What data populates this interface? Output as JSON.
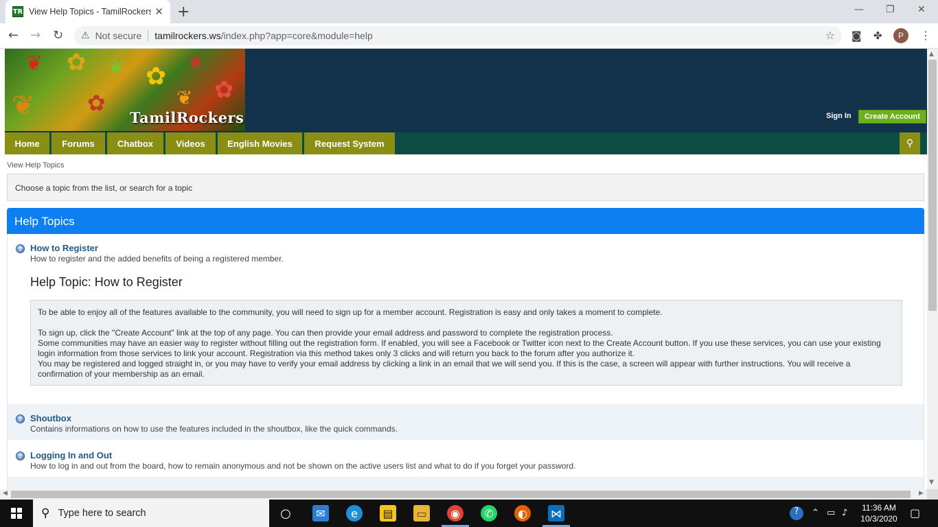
{
  "browser": {
    "tab_title": "View Help Topics - TamilRockers.ws",
    "favicon_text": "TR",
    "not_secure": "Not secure",
    "url_host": "tamilrockers.ws",
    "url_path": "/index.php?app=core&module=help",
    "profile_initial": "P"
  },
  "header": {
    "logo_text": "TamilRockers.com",
    "sign_in": "Sign In",
    "create_account": "Create Account"
  },
  "nav": {
    "items": [
      "Home",
      "Forums",
      "Chatbox",
      "Videos",
      "English Movies",
      "Request System"
    ]
  },
  "page": {
    "breadcrumb": "View Help Topics",
    "info": "Choose a topic from the list, or search for a topic",
    "panel_title": "Help Topics"
  },
  "topics": [
    {
      "title": "How to Register",
      "desc": "How to register and the added benefits of being a registered member."
    },
    {
      "title": "Shoutbox",
      "desc": "Contains informations on how to use the features included in the shoutbox, like the quick commands."
    },
    {
      "title": "Logging In and Out",
      "desc": "How to log in and out from the board, how to remain anonymous and not be shown on the active users list and what to do if you forget your password."
    }
  ],
  "help_topic": {
    "heading": "Help Topic: How to Register",
    "p1": "To be able to enjoy all of the features available to the community, you will need to sign up for a member account. Registration is easy and only takes a moment to complete.",
    "p2": "To sign up, click the \"Create Account\" link at the top of any page. You can then provide your email address and password to complete the registration process.",
    "p3": "Some communities may have an easier way to register without filling out the registration form. If enabled, you will see a Facebook or Twitter icon next to the Create Account button. If you use these services, you can use your existing login information from those services to link your account. Registration via this method takes only 3 clicks and will return you back to the forum after you authorize it.",
    "p4": "You may be registered and logged straight in, or you may have to verify your email address by clicking a link in an email that we will send you. If this is the case, a screen will appear with further instructions. You will receive a confirmation of your membership as an email."
  },
  "taskbar": {
    "search_placeholder": "Type here to search",
    "time": "11:36 AM",
    "date": "10/3/2020"
  },
  "colors": {
    "header_bg": "#12314a",
    "nav_bg": "#0d4c44",
    "nav_item": "#8a8f13",
    "panel_head": "#0d7ff0",
    "create_account": "#6db01b",
    "topic_title": "#225985"
  }
}
